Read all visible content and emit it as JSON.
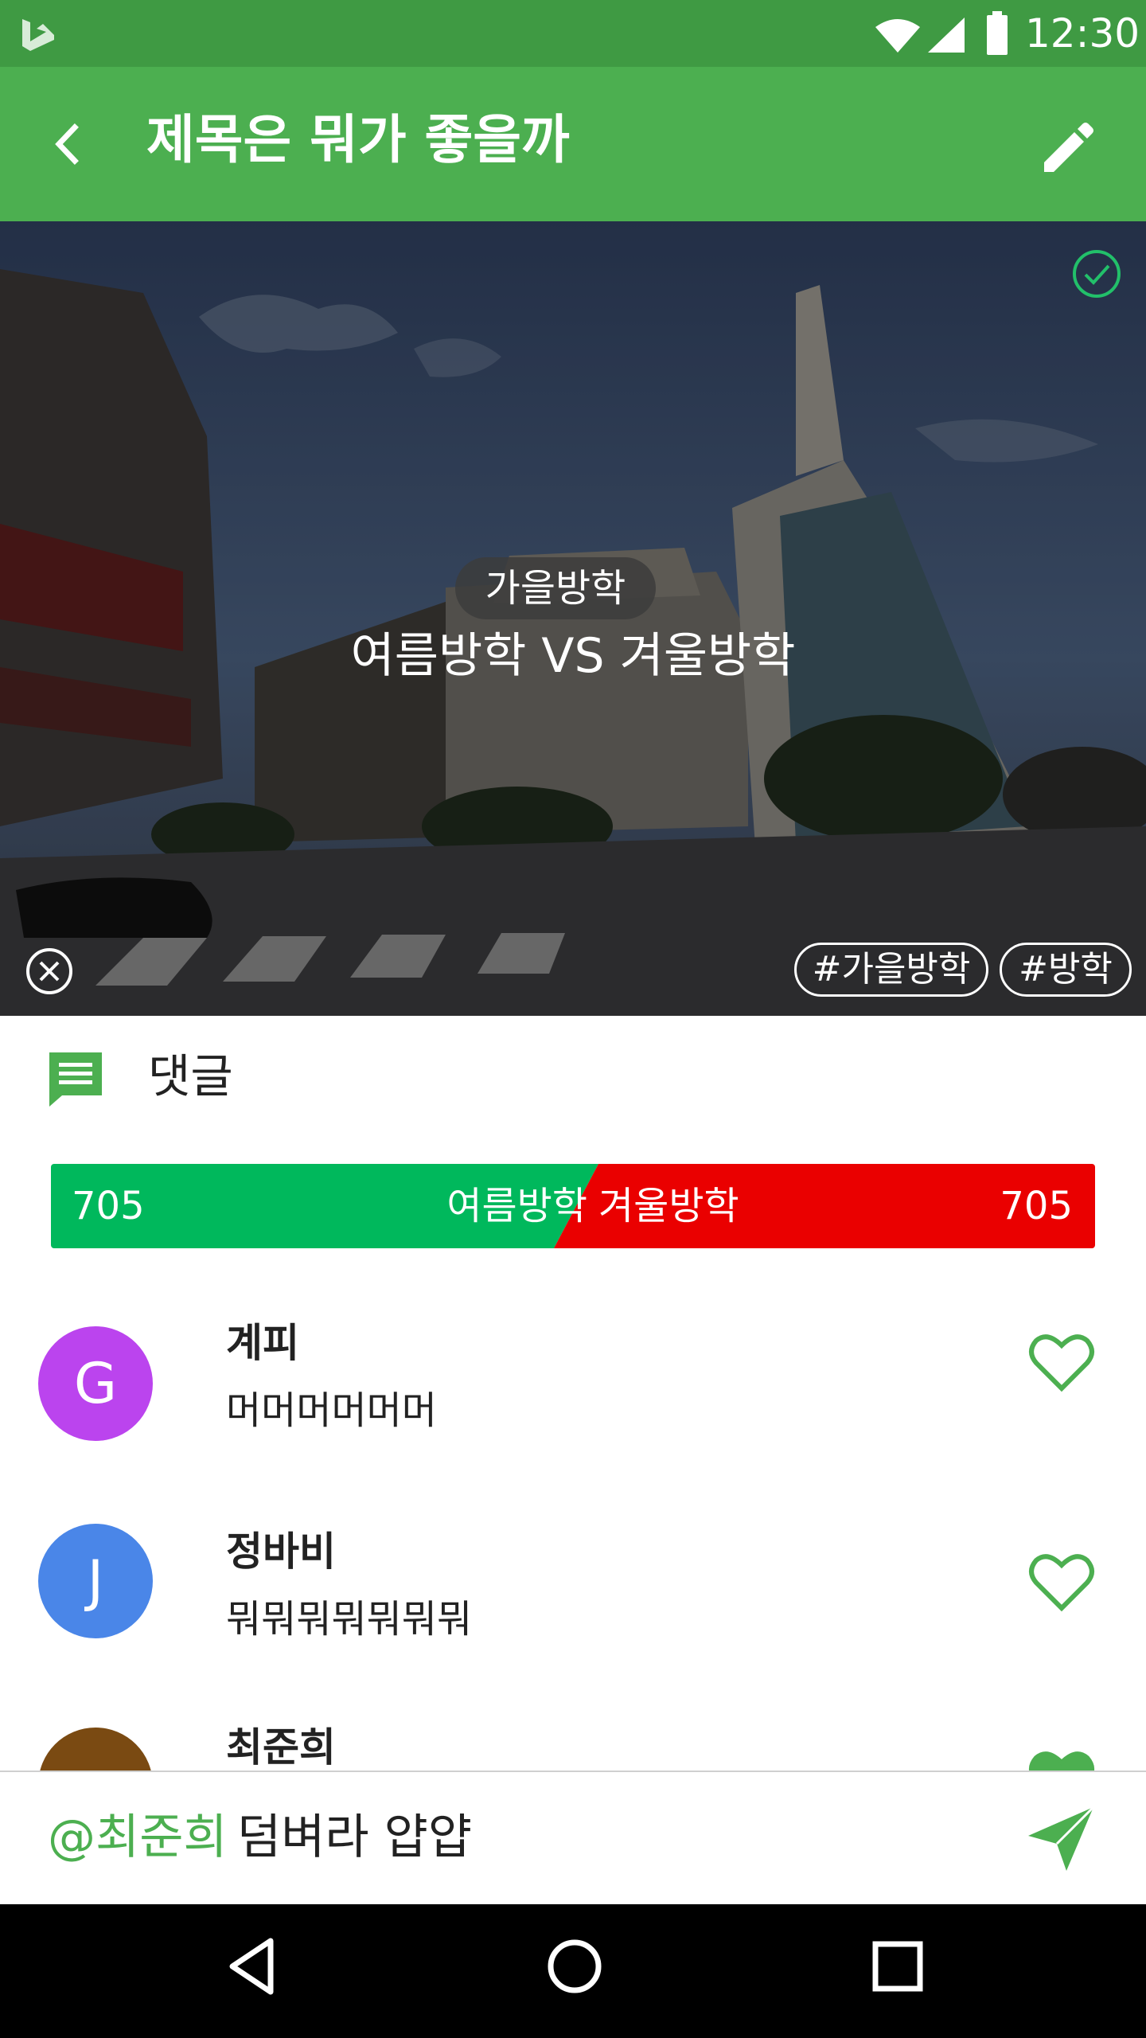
{
  "status_bar": {
    "time": "12:30"
  },
  "app_bar": {
    "title": "제목은 뭐가 좋을까"
  },
  "hero": {
    "category": "가을방학",
    "topic": "여름방학 VS 겨울방학",
    "tags": [
      "#가을방학",
      "#방학"
    ]
  },
  "comments": {
    "label": "댓글",
    "vote": {
      "left": {
        "name": "여름방학",
        "count": "705",
        "color": "#00b85c"
      },
      "right": {
        "name": "겨울방학",
        "count": "705",
        "color": "#ea0000"
      }
    },
    "items": [
      {
        "initial": "G",
        "name": "계피",
        "text": "머머머머머머",
        "avatar_color": "#bb44ee",
        "liked": false
      },
      {
        "initial": "J",
        "name": "정바비",
        "text": "뭐뭐뭐뭐뭐뭐뭐",
        "avatar_color": "#4a86e8",
        "liked": false
      },
      {
        "initial": "",
        "name": "최준희",
        "text": "",
        "avatar_color": "#7a4a12",
        "liked": true
      }
    ]
  },
  "input": {
    "mention": "@최준희",
    "message": "덤벼라 얍얍"
  },
  "colors": {
    "primary": "#4caf50",
    "primary_dark": "#3f9a43",
    "accent": "#4caf50"
  }
}
